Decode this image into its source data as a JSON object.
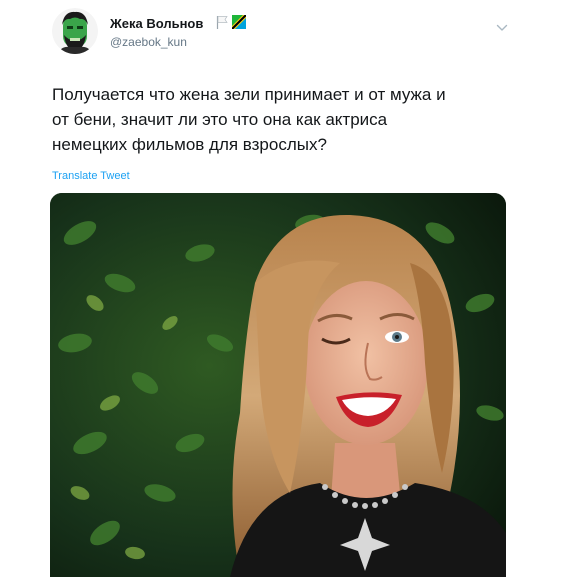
{
  "tweet": {
    "author_name": "Жека Вольнов",
    "author_handle": "@zaebok_kun",
    "text_lines": [
      "Получается что жена зели принимает и от мужа и",
      "от бени, значит ли это что она как актриса",
      "немецких фильмов для взрослых?"
    ],
    "translate_label": "Translate Tweet"
  },
  "icons": {
    "avatar": "hulk-avatar",
    "flag": "white-flag-icon",
    "badge": "tanzania-flag-icon",
    "menu": "chevron-down-icon"
  },
  "colors": {
    "link": "#1da1f2",
    "secondary_text": "#657786",
    "primary_text": "#14171a"
  }
}
